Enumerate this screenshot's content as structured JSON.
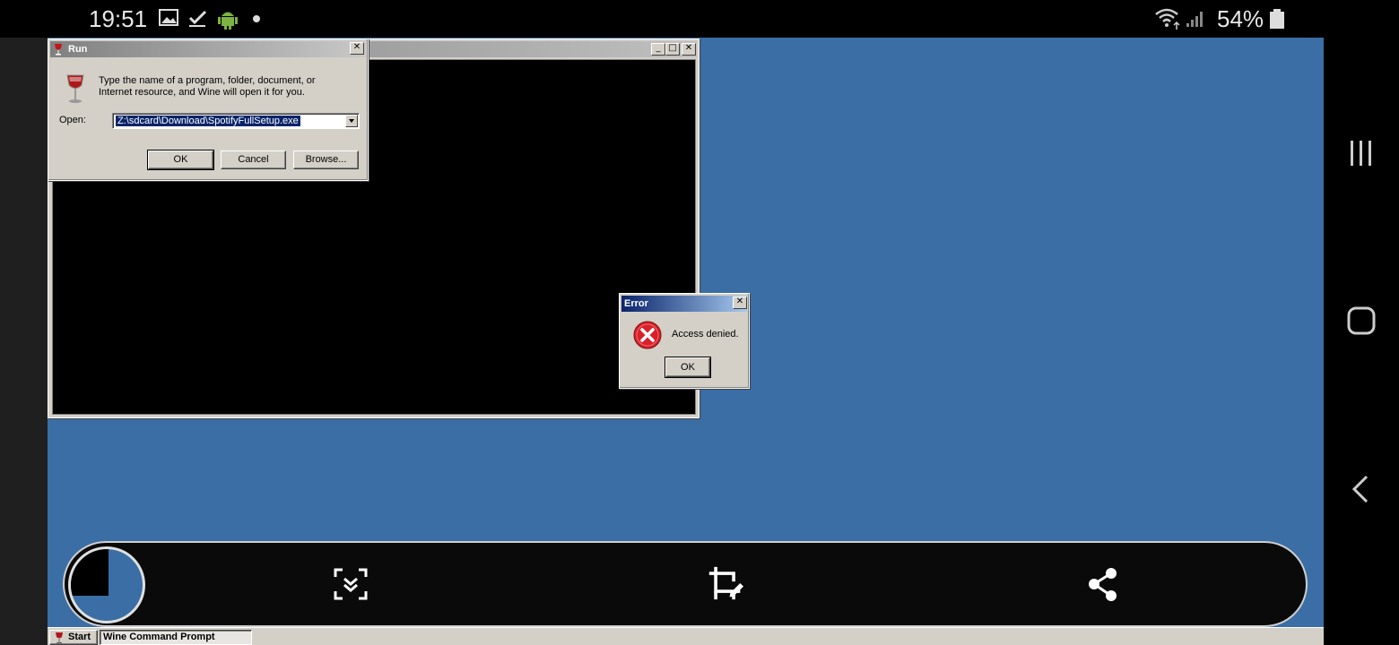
{
  "status_bar": {
    "time": "19:51",
    "battery_percent": "54%",
    "icons": [
      "gallery-icon",
      "check-icon",
      "android-icon",
      "dot-icon",
      "wifi-icon",
      "signal-icon",
      "battery-icon"
    ]
  },
  "run_dialog": {
    "title": "Run",
    "description": "Type the name of a program, folder, document, or Internet resource, and Wine will open it for you.",
    "open_label": "Open:",
    "open_value": "Z:\\sdcard\\Download\\SpotifyFullSetup.exe",
    "ok_label": "OK",
    "cancel_label": "Cancel",
    "browse_label": "Browse..."
  },
  "error_dialog": {
    "title": "Error",
    "message": "Access denied.",
    "ok_label": "OK"
  },
  "taskbar": {
    "start_label": "Start",
    "task_label": "Wine Command Prompt"
  },
  "screenshot_toolbar": {
    "icons": [
      "scroll-capture-icon",
      "crop-edit-icon",
      "share-icon"
    ]
  },
  "nav_bar": {
    "icons": [
      "recents-icon",
      "home-icon",
      "back-icon"
    ]
  },
  "colors": {
    "desktop": "#3a6ea5",
    "dialog_face": "#d4d0c8",
    "active_title": "#0a246a",
    "error_red": "#d9202a"
  }
}
